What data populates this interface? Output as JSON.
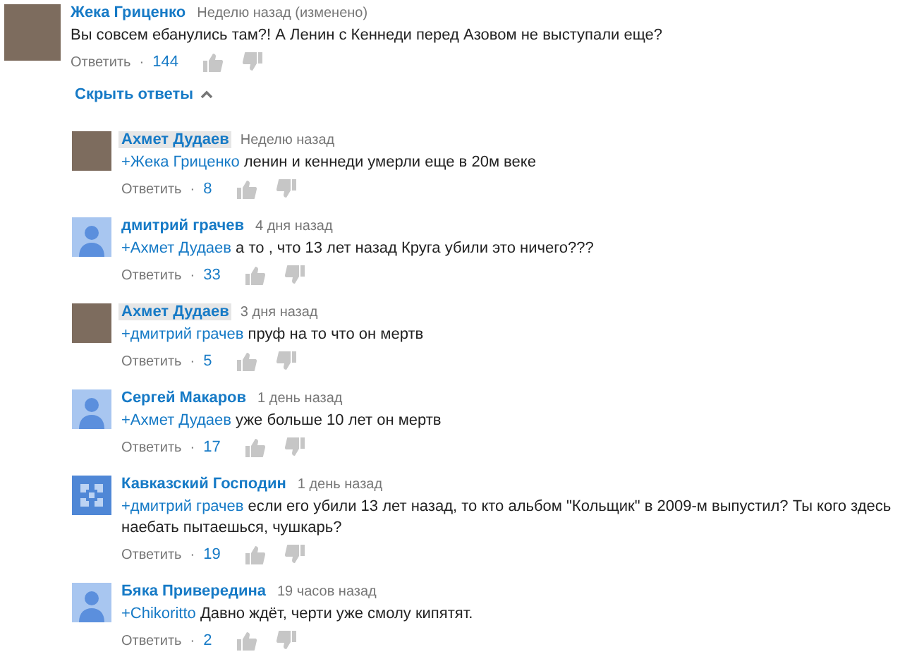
{
  "comment": {
    "author": "Жека Гриценко",
    "time": "Неделю назад (изменено)",
    "avatar": {
      "kind": "photo"
    },
    "text": "Вы совсем ебанулись там?! А Ленин с Кеннеди перед Азовом не выступали еще?",
    "reply_label": "Ответить",
    "separator": "·",
    "likes": "144"
  },
  "hide_replies": {
    "label": "Скрыть ответы"
  },
  "replies": [
    {
      "author": "Ахмет Дудаев",
      "highlighted": true,
      "time": "Неделю назад",
      "avatar": {
        "kind": "photo"
      },
      "mention": "+Жека Гриценко",
      "text": "ленин и кеннеди умерли еще в 20м веке",
      "reply_label": "Ответить",
      "separator": "·",
      "likes": "8"
    },
    {
      "author": "дмитрий грачев",
      "highlighted": false,
      "time": "4 дня назад",
      "avatar": {
        "kind": "default"
      },
      "mention": "+Ахмет Дудаев",
      "text": "а то , что 13 лет назад Круга убили это ничего???",
      "reply_label": "Ответить",
      "separator": "·",
      "likes": "33"
    },
    {
      "author": "Ахмет Дудаев",
      "highlighted": true,
      "time": "3 дня назад",
      "avatar": {
        "kind": "photo"
      },
      "mention": "+дмитрий грачев",
      "text": "пруф на то что он мертв",
      "reply_label": "Ответить",
      "separator": "·",
      "likes": "5"
    },
    {
      "author": "Сергей Макаров",
      "highlighted": false,
      "time": "1 день назад",
      "avatar": {
        "kind": "default"
      },
      "mention": "+Ахмет Дудаев",
      "text": "уже больше 10 лет он мертв",
      "reply_label": "Ответить",
      "separator": "·",
      "likes": "17"
    },
    {
      "author": "Кавказский Господин",
      "highlighted": false,
      "time": "1 день назад",
      "avatar": {
        "kind": "pattern"
      },
      "mention": "+дмитрий грачев",
      "text": "если его убили 13 лет назад, то кто альбом \"Кольщик\" в 2009-м выпустил? Ты кого здесь наебать пытаешься, чушкарь?",
      "reply_label": "Ответить",
      "separator": "·",
      "likes": "19"
    },
    {
      "author": "Бяка Привередина",
      "highlighted": false,
      "time": "19 часов назад",
      "avatar": {
        "kind": "default"
      },
      "mention": "+Chikoritto",
      "text": "Давно ждёт, черти уже смолу кипятят.",
      "reply_label": "Ответить",
      "separator": "·",
      "likes": "2"
    }
  ]
}
